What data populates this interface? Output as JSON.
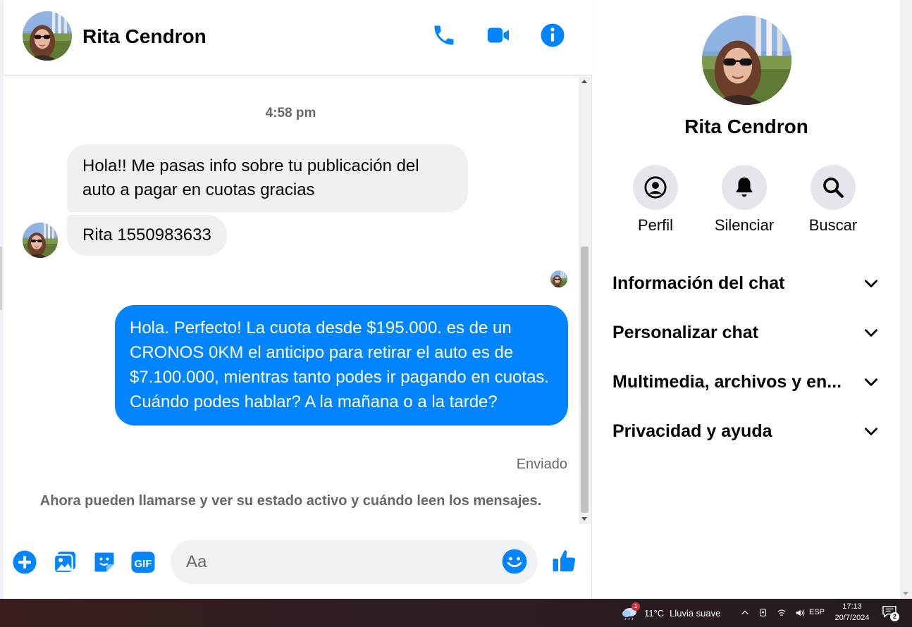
{
  "colors": {
    "accent": "#0084ff",
    "bubble_in": "#f0f0f0",
    "muted": "#65676b"
  },
  "chat": {
    "contact_name": "Rita Cendron",
    "header_icons": [
      "phone-icon",
      "video-camera-icon",
      "info-icon"
    ],
    "timestamp": "4:58 pm",
    "incoming": [
      "Hola!! Me pasas info sobre tu publicación del auto a pagar en cuotas gracias",
      "Rita 1550983633"
    ],
    "outgoing": "Hola. Perfecto! La cuota desde $195.000. es de un CRONOS 0KM el anticipo para retirar el auto es de $7.100.000, mientras tanto podes ir pagando en cuotas. Cuándo podes hablar? A la mañana o a la tarde?",
    "sent_status": "Enviado",
    "notice": "Ahora pueden llamarse y ver su estado activo y cuándo leen los mensajes."
  },
  "composer": {
    "placeholder": "Aa",
    "icons": [
      "plus-icon",
      "photo-icon",
      "sticker-icon",
      "gif-icon",
      "emoji-icon",
      "thumbs-up-icon"
    ],
    "gif_label": "GIF"
  },
  "info": {
    "name": "Rita Cendron",
    "actions": [
      {
        "label": "Perfil",
        "icon": "profile-icon"
      },
      {
        "label": "Silenciar",
        "icon": "bell-icon"
      },
      {
        "label": "Buscar",
        "icon": "search-icon"
      }
    ],
    "sections": [
      "Información del chat",
      "Personalizar chat",
      "Multimedia, archivos y en...",
      "Privacidad y ayuda"
    ]
  },
  "taskbar": {
    "weather_badge": "1",
    "temperature": "11°C",
    "weather_text": "Lluvia suave",
    "language": "ESP",
    "time": "17:13",
    "date": "20/7/2024",
    "notification_count": "2"
  }
}
